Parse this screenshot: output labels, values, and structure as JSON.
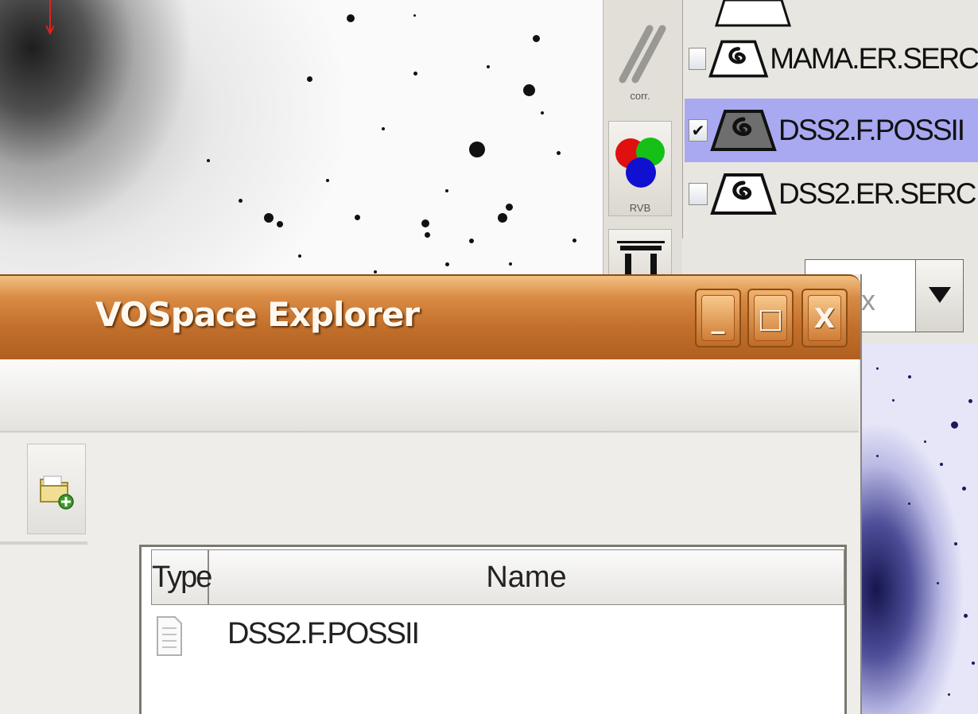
{
  "window": {
    "title": "VOSpace Explorer",
    "minimize_glyph": "_",
    "maximize_glyph": "□",
    "close_glyph": "X"
  },
  "toolbar": {
    "new_folder_icon": "new-folder-icon"
  },
  "table": {
    "columns": [
      "Type",
      "Name"
    ],
    "rows": [
      {
        "type_icon": "file-icon",
        "name": "DSS2.F.POSSII"
      }
    ]
  },
  "aladin_tools": {
    "corr_label": "corr.",
    "rgb_label": "RVB"
  },
  "layer_stack": {
    "layers": [
      {
        "name": "MAMA.ER.SERC",
        "checked": false,
        "selected": false
      },
      {
        "name": "DSS2.F.POSSII",
        "checked": true,
        "selected": true
      },
      {
        "name": "DSS2.ER.SERC",
        "checked": false,
        "selected": false
      }
    ],
    "combo_value": "x"
  },
  "colors": {
    "title_bar": "#c3702c",
    "selected_layer": "#a9a9f2"
  }
}
